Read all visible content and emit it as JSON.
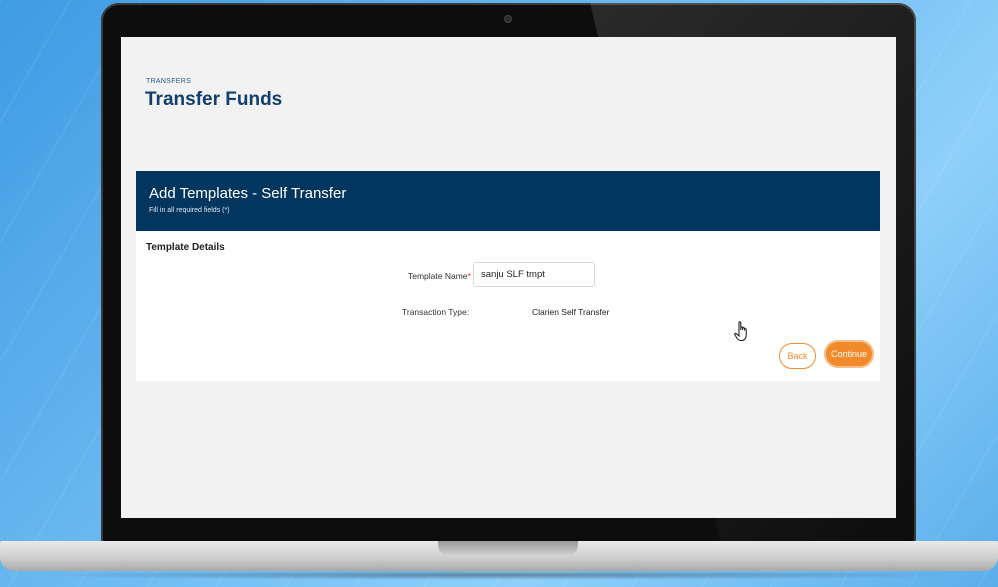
{
  "page": {
    "breadcrumb": "TRANSFERS",
    "title": "Transfer Funds"
  },
  "panel": {
    "title": "Add Templates - Self Transfer",
    "subtitle": "Fill in all required fields (*)",
    "section_label": "Template Details",
    "fields": {
      "template_name_label": "Template Name",
      "template_name_required_mark": "*",
      "template_name_value": "sanju SLF tmpt",
      "transaction_type_label": "Transaction Type:",
      "transaction_type_value": "Clarien Self Transfer"
    },
    "buttons": {
      "back_label": "Back",
      "continue_label": "Continue"
    }
  },
  "colors": {
    "header_bg": "#03365f",
    "accent_orange": "#f08a2a",
    "title_blue": "#123f6d",
    "required_red": "#e0301e"
  },
  "icons": {
    "cursor": "hand-pointer-icon"
  }
}
